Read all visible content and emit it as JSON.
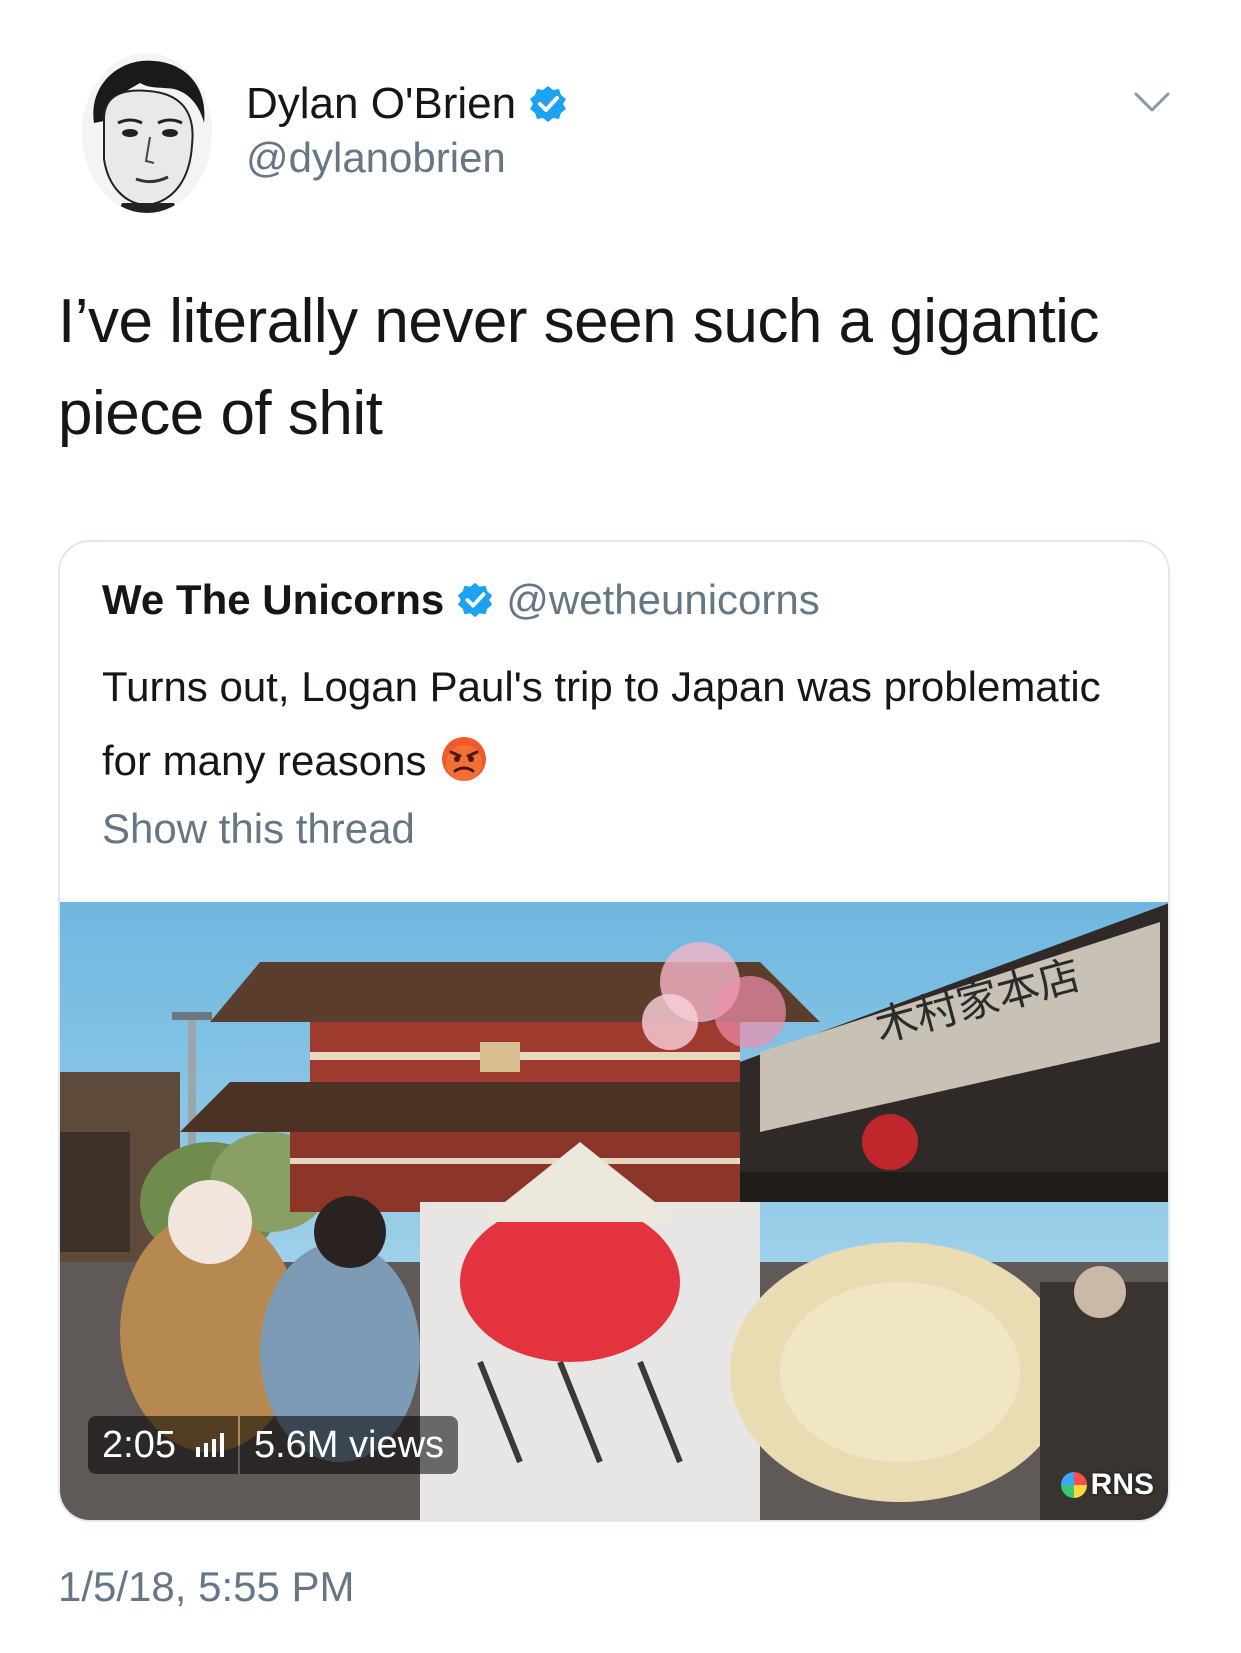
{
  "author": {
    "display_name": "Dylan O'Brien",
    "handle": "@dylanobrien",
    "verified": true
  },
  "tweet": {
    "text": "I’ve literally never seen such a gigantic piece of shit",
    "timestamp": "1/5/18, 5:55 PM"
  },
  "quoted_tweet": {
    "display_name": "We The Unicorns",
    "handle": "@wetheunicorns",
    "verified": true,
    "text": "Turns out, Logan Paul's trip to Japan was problematic for many reasons",
    "emoji": "angry-face",
    "show_thread_label": "Show this thread",
    "video": {
      "duration": "2:05",
      "views": "5.6M views",
      "watermark": "RNS"
    }
  },
  "colors": {
    "text_primary": "#14171a",
    "text_secondary": "#657786",
    "verified_blue": "#1da1f2",
    "card_border": "#e1e8ed"
  },
  "icons": {
    "caret": "chevron-down-icon",
    "verified": "verified-badge-icon",
    "signal": "signal-bars-icon"
  }
}
